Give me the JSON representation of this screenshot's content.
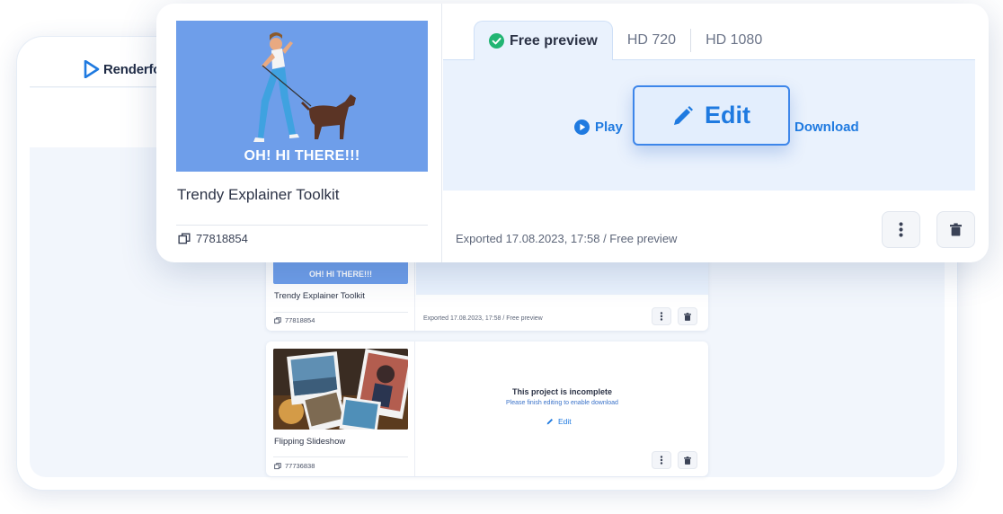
{
  "app": {
    "brand": "Renderforest",
    "brand_visible": "Renderforˌ"
  },
  "featured_project": {
    "thumbnail_caption": "OH! HI THERE!!!",
    "title": "Trendy Explainer Toolkit",
    "id": "77818854",
    "tabs": [
      {
        "label": "Free preview",
        "active": true,
        "icon": "check-circle-icon"
      },
      {
        "label": "HD 720",
        "active": false
      },
      {
        "label": "HD 1080",
        "active": false
      }
    ],
    "actions": {
      "play_label": "Play",
      "edit_label": "Edit",
      "download_label": "Download"
    },
    "exported_text": "Exported 17.08.2023, 17:58 / Free preview"
  },
  "projects": [
    {
      "thumbnail_caption": "OH! HI THERE!!!",
      "title": "Trendy Explainer Toolkit",
      "id": "77818854",
      "exported_text": "Exported 17.08.2023, 17:58 / Free preview"
    },
    {
      "title": "Flipping Slideshow",
      "id": "77736838",
      "incomplete_title": "This project is incomplete",
      "incomplete_message": "Please finish editing to enable download",
      "edit_label": "Edit"
    }
  ],
  "colors": {
    "accent": "#1f7ae0",
    "panel_bg": "#eaf2fd",
    "thumb_bg": "#6e9eea",
    "success": "#22b573"
  }
}
